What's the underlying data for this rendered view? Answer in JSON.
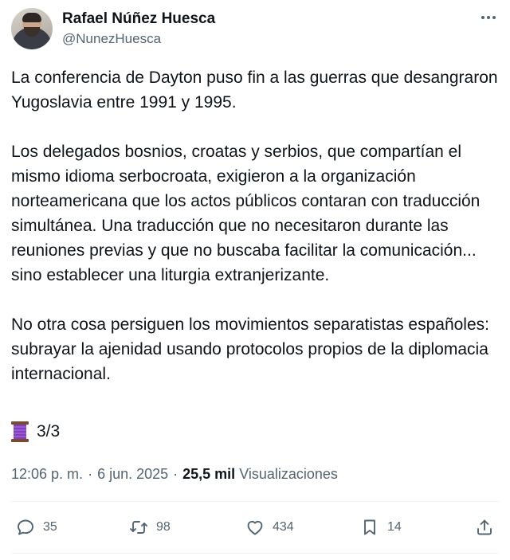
{
  "author": {
    "display_name": "Rafael Núñez Huesca",
    "handle": "@NunezHuesca",
    "avatar_icon": "user-avatar"
  },
  "tweet": {
    "paragraphs": [
      "La conferencia de Dayton puso fin a las guerras que desangraron Yugoslavia entre 1991 y 1995.",
      "Los delegados bosnios, croatas y serbios, que compartían el mismo idioma serbocroata, exigieron a la organización norteamericana que los actos públicos contaran con traducción simultánea. Una traducción que no necesitaron durante las reuniones previas y que no buscaba facilitar la comunicación... sino establecer una liturgia extranjerizante.",
      "No otra cosa persiguen los movimientos separatistas españoles: subrayar la ajenidad usando protocolos propios de la diplomacia internacional."
    ],
    "thread_emoji": "thread-spool-icon",
    "thread_counter": "3/3"
  },
  "meta": {
    "time": "12:06 p. m.",
    "separator": "·",
    "date": "6 jun. 2025",
    "views_count": "25,5 mil",
    "views_label": "Visualizaciones"
  },
  "actions": {
    "replies": "35",
    "reposts": "98",
    "likes": "434",
    "bookmarks": "14"
  },
  "colors": {
    "text": "#0f1419",
    "secondary": "#536471",
    "divider": "#eff3f4"
  }
}
